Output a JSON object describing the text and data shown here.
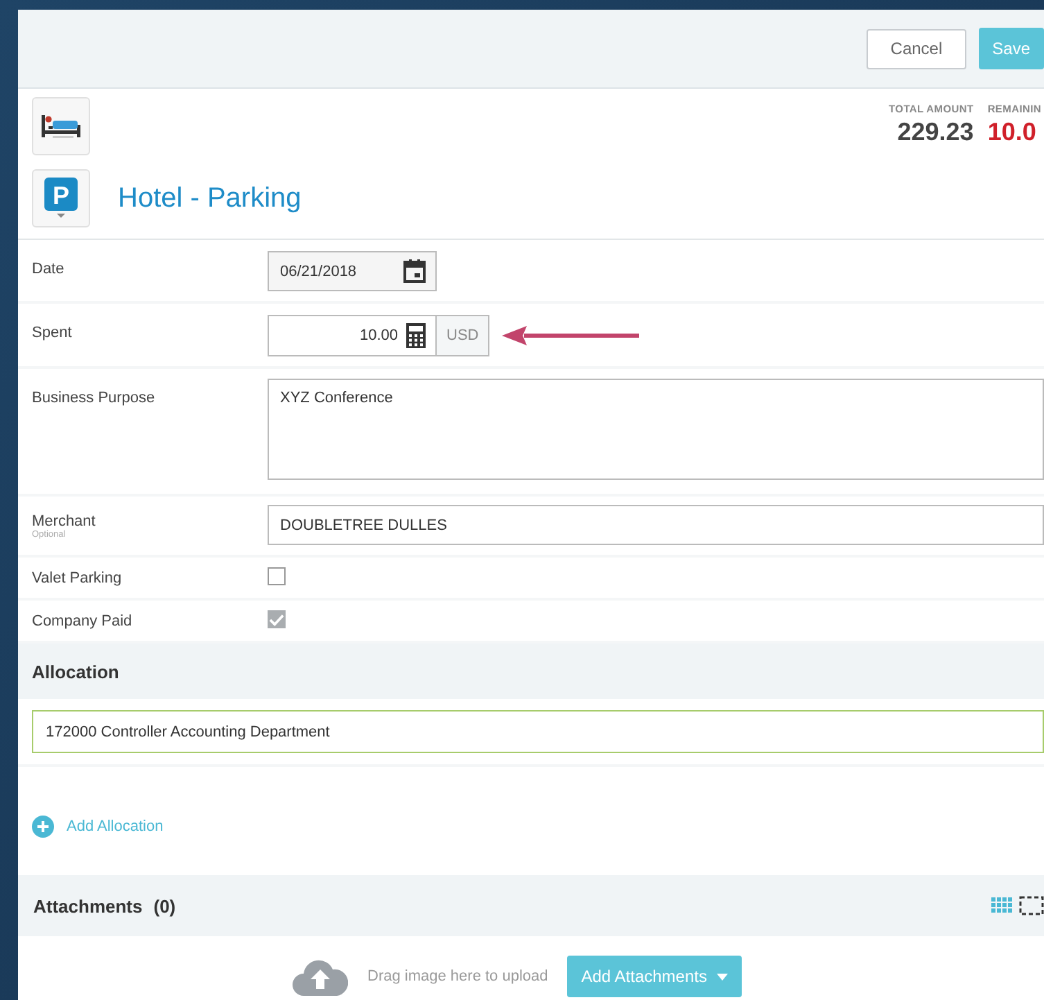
{
  "header": {
    "buttons": [
      {
        "label": "Cancel",
        "kind": "secondary"
      },
      {
        "label": "Save",
        "kind": "primary"
      }
    ]
  },
  "summary": [
    {
      "label": "TOTAL AMOUNT",
      "value": "229.23",
      "kind": "normal"
    },
    {
      "label": "REMAININ",
      "value": "10.0",
      "kind": "alert"
    }
  ],
  "expense_type": {
    "icon_letter": "P",
    "title": "Hotel - Parking"
  },
  "fields": [
    {
      "kind": "date",
      "label": "Date",
      "value": "06/21/2018"
    },
    {
      "kind": "amount",
      "label": "Spent",
      "value": "10.00",
      "currency": "USD"
    },
    {
      "kind": "textarea",
      "label": "Business Purpose",
      "value": "XYZ Conference"
    },
    {
      "kind": "text",
      "label": "Merchant",
      "hint": "Optional",
      "value": "DOUBLETREE DULLES"
    },
    {
      "kind": "checkbox",
      "label": "Valet Parking",
      "checked": false,
      "disabled": false
    },
    {
      "kind": "checkbox",
      "label": "Company Paid",
      "checked": true,
      "disabled": true
    }
  ],
  "allocation": {
    "title": "Allocation",
    "value": "172000 Controller Accounting Department",
    "add_label": "Add Allocation"
  },
  "attachments": {
    "title": "Attachments",
    "count": "(0)",
    "drop_hint": "Drag image here to upload",
    "button": "Add Attachments"
  }
}
